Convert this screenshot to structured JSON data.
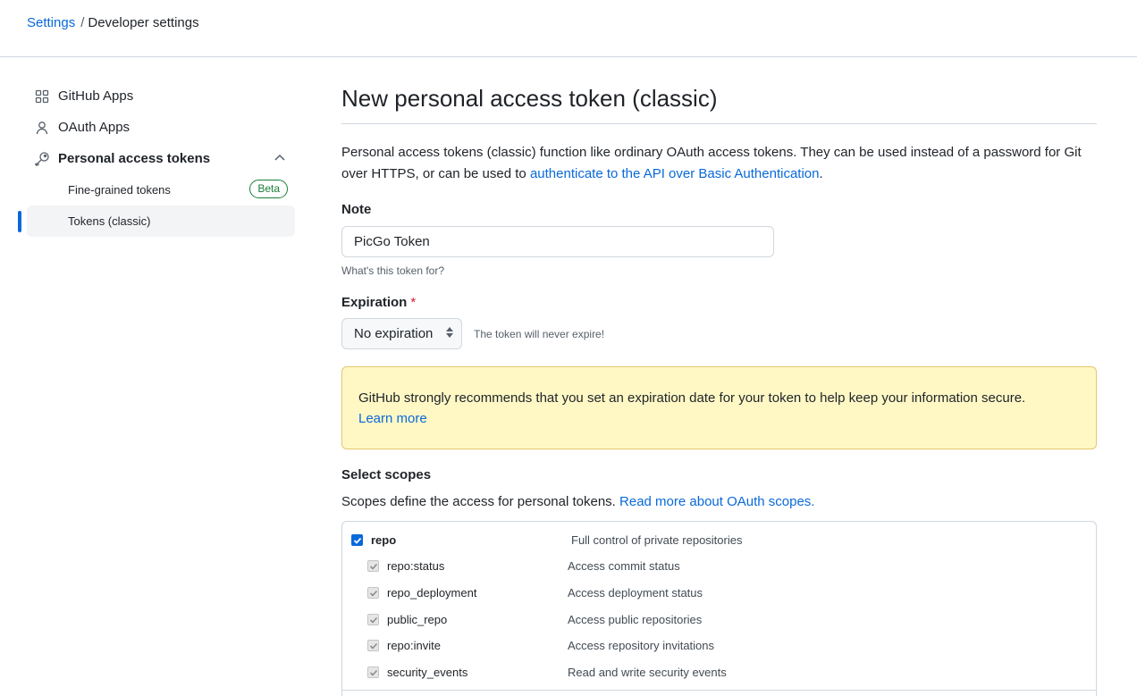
{
  "breadcrumb": {
    "root": "Settings",
    "separator": "/",
    "current": "Developer settings"
  },
  "sidebar": {
    "items": [
      {
        "label": "GitHub Apps",
        "icon": "apps-grid-icon"
      },
      {
        "label": "OAuth Apps",
        "icon": "person-icon"
      },
      {
        "label": "Personal access tokens",
        "icon": "key-icon"
      }
    ],
    "sub_items": [
      {
        "label": "Fine-grained tokens",
        "badge": "Beta"
      },
      {
        "label": "Tokens (classic)"
      }
    ]
  },
  "main": {
    "title": "New personal access token (classic)",
    "intro_text": "Personal access tokens (classic) function like ordinary OAuth access tokens. They can be used instead of a password for Git over HTTPS, or can be used to ",
    "intro_link": "authenticate to the API over Basic Authentication",
    "intro_end": ".",
    "note_label": "Note",
    "note_value": "PicGo Token",
    "note_hint": "What's this token for?",
    "expiration_label": "Expiration",
    "expiration_required": "*",
    "expiration_value": "No expiration",
    "expiration_note": "The token will never expire!",
    "warning_text": "GitHub strongly recommends that you set an expiration date for your token to help keep your information secure.",
    "warning_link": "Learn more",
    "scopes_title": "Select scopes",
    "scopes_desc": "Scopes define the access for personal tokens. ",
    "scopes_link": "Read more about OAuth scopes."
  },
  "scopes": [
    {
      "name": "repo",
      "desc": "Full control of private repositories",
      "checked": true,
      "main": true
    },
    {
      "name": "repo:status",
      "desc": "Access commit status",
      "checked": true,
      "main": false
    },
    {
      "name": "repo_deployment",
      "desc": "Access deployment status",
      "checked": true,
      "main": false
    },
    {
      "name": "public_repo",
      "desc": "Access public repositories",
      "checked": true,
      "main": false
    },
    {
      "name": "repo:invite",
      "desc": "Access repository invitations",
      "checked": true,
      "main": false
    },
    {
      "name": "security_events",
      "desc": "Read and write security events",
      "checked": true,
      "main": false
    }
  ],
  "colors": {
    "accent": "#0969da",
    "warning_bg": "#fff8c5",
    "beta_green": "#1a7f37"
  }
}
